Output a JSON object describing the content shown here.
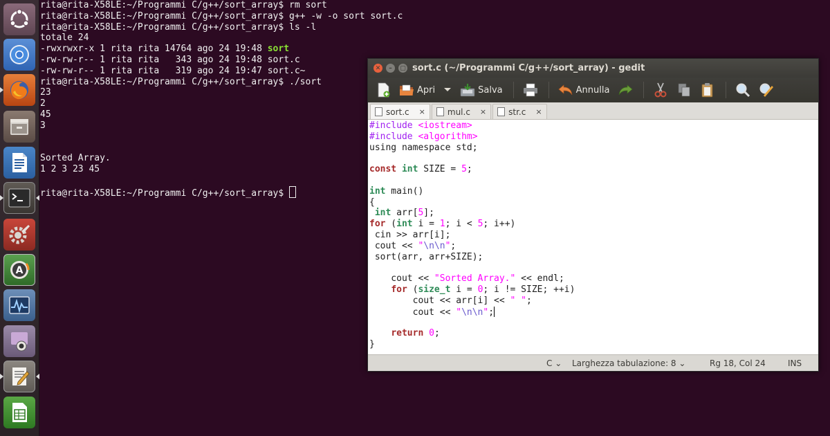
{
  "launcher": {
    "items": [
      {
        "name": "ubuntu-dash-icon"
      },
      {
        "name": "chromium-icon"
      },
      {
        "name": "firefox-icon"
      },
      {
        "name": "files-icon"
      },
      {
        "name": "libreoffice-writer-icon"
      },
      {
        "name": "terminal-icon"
      },
      {
        "name": "system-settings-icon"
      },
      {
        "name": "software-updater-icon"
      },
      {
        "name": "system-monitor-icon"
      },
      {
        "name": "cheese-webcam-icon"
      },
      {
        "name": "text-editor-icon"
      },
      {
        "name": "libreoffice-calc-icon"
      }
    ]
  },
  "terminal": {
    "lines": [
      "rita@rita-X58LE:~/Programmi C/g++/sort_array$ rm sort",
      "rita@rita-X58LE:~/Programmi C/g++/sort_array$ g++ -w -o sort sort.c",
      "rita@rita-X58LE:~/Programmi C/g++/sort_array$ ls -l",
      "totale 24",
      "-rwxrwxr-x 1 rita rita 14764 ago 24 19:48 ",
      "-rw-rw-r-- 1 rita rita   343 ago 24 19:48 sort.c",
      "-rw-rw-r-- 1 rita rita   319 ago 24 19:47 sort.c~",
      "rita@rita-X58LE:~/Programmi C/g++/sort_array$ ./sort",
      "23",
      "2",
      "45",
      "3",
      "",
      "",
      "Sorted Array.",
      "1 2 3 23 45",
      "",
      "rita@rita-X58LE:~/Programmi C/g++/sort_array$ "
    ],
    "executable_name": "sort"
  },
  "gedit": {
    "title": "sort.c (~/Programmi C/g++/sort_array) - gedit",
    "toolbar": {
      "open_label": "Apri",
      "save_label": "Salva",
      "undo_label": "Annulla"
    },
    "tabs": [
      {
        "label": "sort.c",
        "close": "×"
      },
      {
        "label": "mul.c",
        "close": "×"
      },
      {
        "label": "str.c",
        "close": "×"
      }
    ],
    "statusbar": {
      "language": "C",
      "tab_width": "Larghezza tabulazione: 8",
      "position": "Rg 18, Col 24",
      "mode": "INS"
    }
  }
}
